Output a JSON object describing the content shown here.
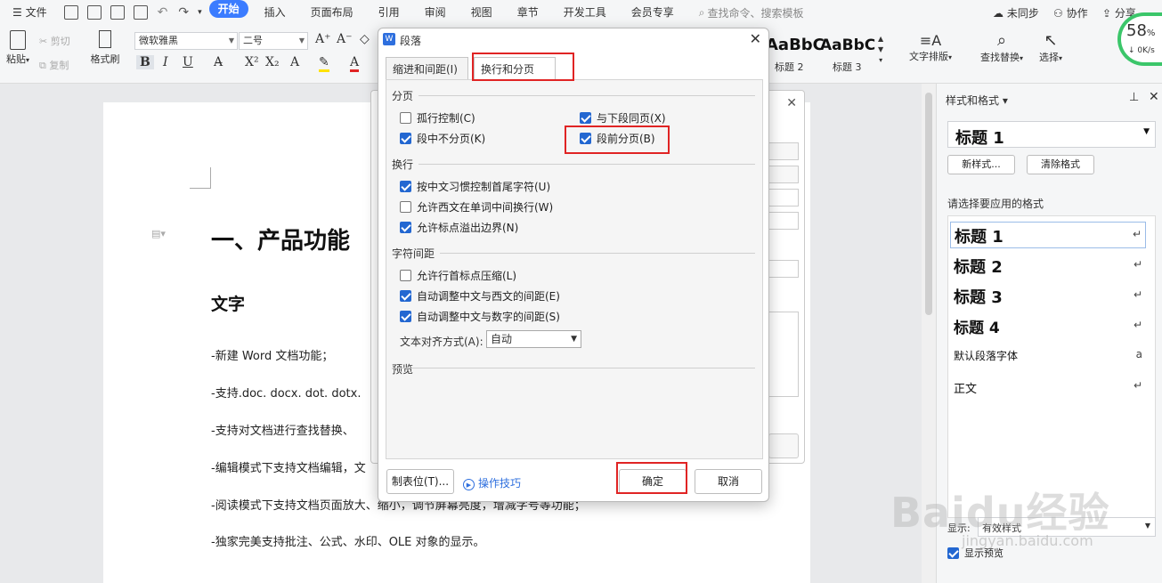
{
  "menubar": {
    "file": "文件",
    "tabs": [
      "开始",
      "插入",
      "页面布局",
      "引用",
      "审阅",
      "视图",
      "章节",
      "开发工具",
      "会员专享"
    ],
    "active_tab": "开始",
    "search": "查找命令、搜索模板",
    "sync": "未同步",
    "collab": "协作",
    "share": "分享"
  },
  "ribbon": {
    "paste": "粘贴",
    "cut": "剪切",
    "copy": "复制",
    "format_painter": "格式刷",
    "font_name": "微软雅黑",
    "font_size": "二号",
    "style_sample": "AaBbC",
    "style_sample2": "AaBbC",
    "style_label_1": "标题 2",
    "style_label_2": "标题 3",
    "text_layout": "文字排版",
    "find_replace": "查找替换",
    "select": "选择"
  },
  "speed": {
    "percent": "58",
    "unit": "%",
    "rate": "0K/s"
  },
  "document": {
    "heading1": "一、产品功能",
    "heading2": "文字",
    "lines": [
      "-新建 Word 文档功能；",
      "-支持.doc. docx. dot. dotx.",
      "-支持对文档进行查找替换、",
      "-编辑模式下支持文档编辑，文",
      "-阅读模式下支持文档页面放大、缩小，调节屏幕亮度，增减字号等功能；",
      "-独家完美支持批注、公式、水印、OLE 对象的显示。"
    ]
  },
  "right_panel": {
    "title": "样式和格式",
    "current_style": "标题  1",
    "new_style": "新样式...",
    "clear_format": "清除格式",
    "prompt": "请选择要应用的格式",
    "styles": [
      {
        "label": "标题  1",
        "mark": "↵"
      },
      {
        "label": "标题  2",
        "mark": "↵"
      },
      {
        "label": "标题  3",
        "mark": "↵"
      },
      {
        "label": "标题  4",
        "mark": "↵"
      },
      {
        "label": "默认段落字体",
        "mark": "a"
      },
      {
        "label": "正文",
        "mark": "↵"
      }
    ],
    "show_label": "显示:",
    "show_value": "有效样式",
    "show_preview": "显示预览"
  },
  "dialog": {
    "title": "段落",
    "tabs": [
      "缩进和间距(I)",
      "换行和分页(P)"
    ],
    "active_tab": "换行和分页(P)",
    "pagination": {
      "header": "分页",
      "widow": {
        "label": "孤行控制(C)",
        "checked": false
      },
      "keep_next": {
        "label": "与下段同页(X)",
        "checked": true
      },
      "keep_lines": {
        "label": "段中不分页(K)",
        "checked": true
      },
      "page_break_before": {
        "label": "段前分页(B)",
        "checked": true
      }
    },
    "linebreak": {
      "header": "换行",
      "items": [
        {
          "label": "按中文习惯控制首尾字符(U)",
          "checked": true
        },
        {
          "label": "允许西文在单词中间换行(W)",
          "checked": false
        },
        {
          "label": "允许标点溢出边界(N)",
          "checked": true
        }
      ]
    },
    "spacing": {
      "header": "字符间距",
      "items": [
        {
          "label": "允许行首标点压缩(L)",
          "checked": false
        },
        {
          "label": "自动调整中文与西文的间距(E)",
          "checked": true
        },
        {
          "label": "自动调整中文与数字的间距(S)",
          "checked": true
        }
      ],
      "align_label": "文本对齐方式(A):",
      "align_value": "自动"
    },
    "preview": "预览",
    "tabs_button": "制表位(T)...",
    "tips": "操作技巧",
    "ok": "确定",
    "cancel": "取消"
  },
  "colors": {
    "accent": "#3b7cff",
    "check": "#2367d1",
    "highlight": "#e02424"
  }
}
